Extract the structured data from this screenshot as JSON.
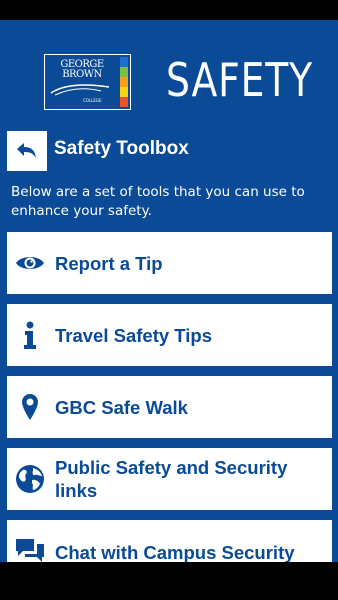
{
  "colors": {
    "primary": "#0a4a96",
    "card_background": "#ffffff",
    "system_bars": "#000000",
    "logo_stripes": [
      "#1e6fd1",
      "#7ac143",
      "#f6a01a",
      "#f5d716",
      "#e8532d"
    ]
  },
  "header": {
    "logo_text": "GEORGE BROWN",
    "logo_subtext": "COLLEGE",
    "title": "SAFETY"
  },
  "toolbox": {
    "back_icon": "back-arrow-icon",
    "title": "Safety Toolbox",
    "description": "Below are a set of tools that you can use to enhance your safety.",
    "items": [
      {
        "label": "Report a Tip",
        "icon": "eye-icon"
      },
      {
        "label": "Travel Safety Tips",
        "icon": "info-icon"
      },
      {
        "label": "GBC Safe Walk",
        "icon": "map-pin-icon"
      },
      {
        "label": "Public Safety and Security links",
        "icon": "globe-icon"
      },
      {
        "label": "Chat with Campus Security",
        "icon": "chat-icon"
      }
    ]
  }
}
